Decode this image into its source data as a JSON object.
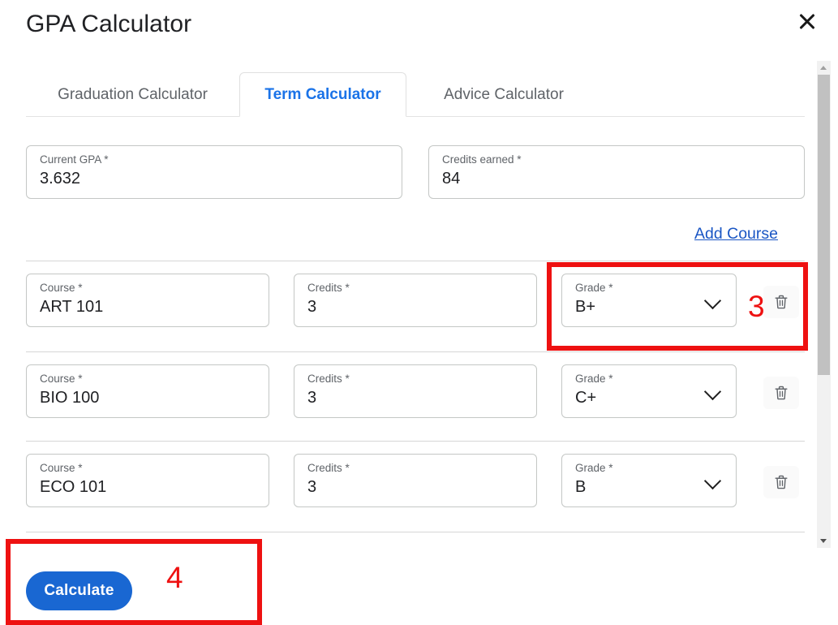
{
  "dialog": {
    "title": "GPA Calculator",
    "close_icon": "close-icon"
  },
  "tabs": [
    {
      "label": "Graduation Calculator",
      "active": false
    },
    {
      "label": "Term Calculator",
      "active": true
    },
    {
      "label": "Advice Calculator",
      "active": false
    }
  ],
  "summary": {
    "current_gpa": {
      "label": "Current GPA *",
      "value": "3.632"
    },
    "credits_earned": {
      "label": "Credits earned *",
      "value": "84"
    }
  },
  "actions": {
    "add_course_label": "Add Course",
    "calculate_label": "Calculate"
  },
  "course_fields": {
    "course_label": "Course *",
    "credits_label": "Credits *",
    "grade_label": "Grade *",
    "delete_icon": "trash-icon",
    "dropdown_icon": "chevron-down-icon"
  },
  "courses": [
    {
      "course": "ART 101",
      "credits": "3",
      "grade": "B+"
    },
    {
      "course": "BIO 100",
      "credits": "3",
      "grade": "C+"
    },
    {
      "course": "ECO 101",
      "credits": "3",
      "grade": "B"
    }
  ],
  "annotations": [
    {
      "number": "3",
      "target": "grade-dropdown-row-1"
    },
    {
      "number": "4",
      "target": "calculate-button"
    }
  ],
  "colors": {
    "accent_blue": "#1a73e8",
    "button_blue": "#1967d2",
    "link_blue": "#1a56c4",
    "annotation_red": "#ee1111",
    "label_gray": "#5f6368",
    "border_gray": "#c4c7c5"
  },
  "scrollbar": {
    "up_arrow_icon": "triangle-up-icon",
    "down_arrow_icon": "triangle-down-icon"
  }
}
